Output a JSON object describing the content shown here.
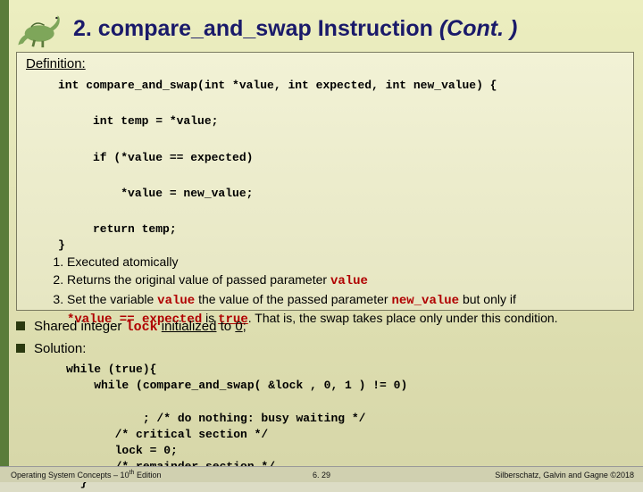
{
  "title": {
    "main": "2. compare_and_swap Instruction ",
    "cont": "(Cont. )"
  },
  "defbox": {
    "header": "Definition:",
    "code": "int compare_and_swap(int *value, int expected, int new_value) {\n\n     int temp = *value;\n\n     if (*value == expected)\n\n         *value = new_value;\n\n     return temp;",
    "brace": "}",
    "notes": {
      "0": "Executed atomically",
      "1a": "Returns the original value of passed parameter ",
      "1b": "value",
      "2a": "Set  the variable ",
      "2b": "value",
      "2c": " the value of the passed parameter ",
      "2d": "new_value",
      "2e": " but only if",
      "2f": "*value == expected",
      "2g": " is ",
      "2h": "true",
      "2i": ". That is, the swap takes place only under this condition."
    }
  },
  "below": {
    "shared": {
      "a": "Shared integer  ",
      "b": "lock",
      "c": "  initialized",
      "d": " to ",
      "e": "0",
      "f": ";"
    },
    "solution_label": "Solution:",
    "solution_code": "while (true){\n    while (compare_and_swap( &lock , 0, 1 ) != 0)\n\n           ; /* do nothing: busy waiting */\n       /* critical section */\n       lock = 0;\n       /* remainder section */\n  }"
  },
  "footer": {
    "left_a": "Operating System Concepts – 10",
    "left_sup": "th",
    "left_b": " Edition",
    "center": "6. 29",
    "right": "Silberschatz, Galvin and Gagne ©2018"
  }
}
